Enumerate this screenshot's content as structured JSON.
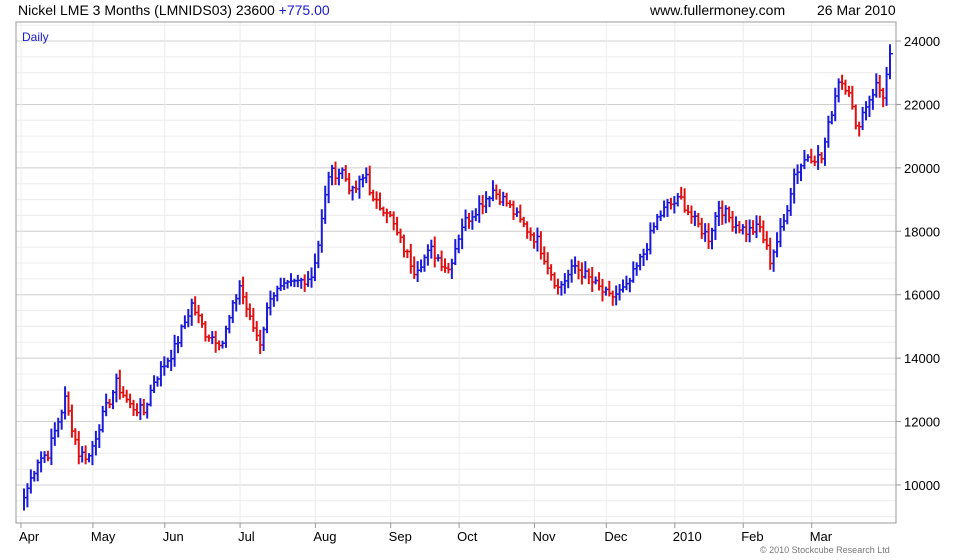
{
  "header": {
    "title": "Nickel LME 3 Months (LMNIDS03)",
    "last": "23600",
    "change": "+775.00",
    "source": "www.fullermoney.com",
    "date": "26 Mar 2010"
  },
  "copyright": "© 2010 Stockcube Research Ltd",
  "colors": {
    "up": "#1a1ad8",
    "down": "#e01010",
    "grid_major": "#d0d0d0",
    "grid_minor": "#ececec",
    "frame": "#999999",
    "label": "#1a1ad0"
  },
  "chart_data": {
    "type": "bar",
    "subtype": "daily-hlc",
    "period_label": "Daily",
    "ylim": [
      8800,
      24600
    ],
    "y_ticks": [
      10000,
      12000,
      14000,
      16000,
      18000,
      20000,
      22000,
      24000
    ],
    "y_tick_labels": [
      "10000",
      "12000",
      "14000",
      "16000",
      "18000",
      "20000",
      "22000",
      "24000"
    ],
    "x_months": [
      "Apr",
      "May",
      "Jun",
      "Jul",
      "Aug",
      "Sep",
      "Oct",
      "Nov",
      "Dec",
      "2010",
      "Feb",
      "Mar"
    ],
    "x_month_start_index": [
      0,
      21,
      42,
      64,
      86,
      108,
      128,
      150,
      171,
      191,
      211,
      231
    ],
    "key_closes": [
      [
        0,
        9600
      ],
      [
        4,
        10800
      ],
      [
        7,
        11000
      ],
      [
        12,
        12700
      ],
      [
        16,
        11000
      ],
      [
        19,
        10900
      ],
      [
        22,
        11900
      ],
      [
        27,
        13200
      ],
      [
        31,
        12500
      ],
      [
        35,
        12300
      ],
      [
        38,
        13300
      ],
      [
        44,
        14300
      ],
      [
        49,
        15700
      ],
      [
        53,
        14800
      ],
      [
        58,
        14500
      ],
      [
        63,
        16300
      ],
      [
        66,
        15200
      ],
      [
        69,
        14500
      ],
      [
        72,
        16000
      ],
      [
        76,
        16200
      ],
      [
        84,
        16600
      ],
      [
        86,
        17600
      ],
      [
        89,
        19800
      ],
      [
        93,
        19900
      ],
      [
        96,
        19200
      ],
      [
        100,
        19800
      ],
      [
        102,
        18900
      ],
      [
        106,
        18700
      ],
      [
        109,
        17900
      ],
      [
        114,
        16800
      ],
      [
        119,
        17400
      ],
      [
        124,
        16800
      ],
      [
        128,
        18200
      ],
      [
        132,
        18700
      ],
      [
        137,
        19300
      ],
      [
        141,
        18900
      ],
      [
        145,
        18300
      ],
      [
        150,
        17700
      ],
      [
        156,
        16200
      ],
      [
        161,
        16900
      ],
      [
        165,
        16500
      ],
      [
        171,
        15900
      ],
      [
        176,
        16200
      ],
      [
        181,
        17300
      ],
      [
        185,
        18400
      ],
      [
        188,
        18800
      ],
      [
        192,
        19000
      ],
      [
        196,
        18300
      ],
      [
        200,
        17800
      ],
      [
        203,
        18800
      ],
      [
        207,
        18300
      ],
      [
        211,
        18000
      ],
      [
        215,
        18100
      ],
      [
        218,
        17100
      ],
      [
        222,
        18300
      ],
      [
        225,
        19800
      ],
      [
        229,
        20400
      ],
      [
        233,
        20300
      ],
      [
        236,
        21800
      ],
      [
        238,
        22800
      ],
      [
        241,
        22500
      ],
      [
        243,
        21200
      ],
      [
        246,
        22000
      ],
      [
        249,
        22600
      ],
      [
        251,
        22300
      ],
      [
        252,
        22900
      ],
      [
        253,
        23600
      ]
    ],
    "last_close": 23600,
    "change": 775.0
  }
}
